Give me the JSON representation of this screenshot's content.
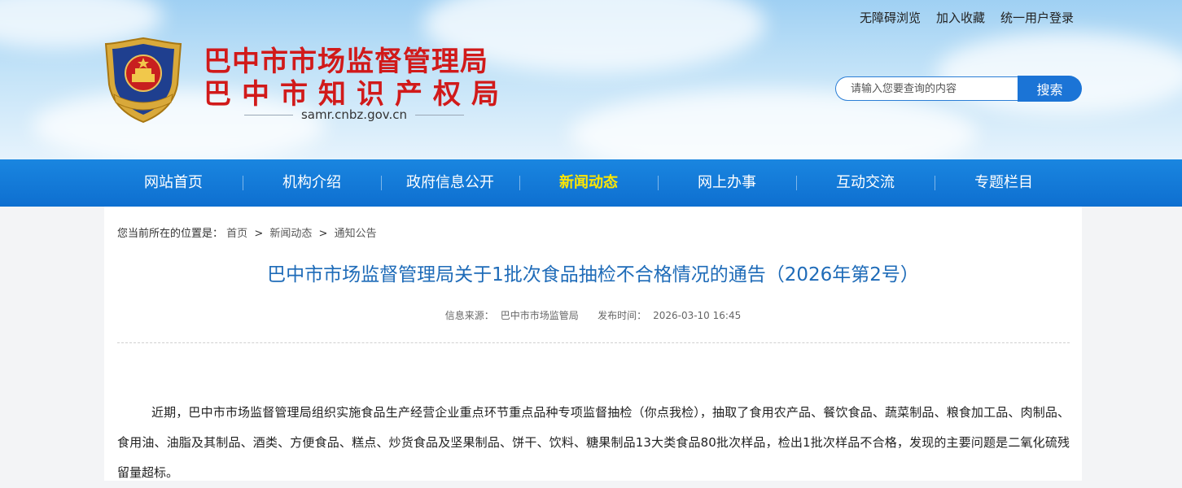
{
  "header": {
    "top_links": [
      "无障碍浏览",
      "加入收藏",
      "统一用户登录"
    ],
    "title_line1": "巴中市市场监督管理局",
    "title_line2": "巴中市知识产权局",
    "domain": "samr.cnbz.gov.cn",
    "emblem_text": "市场监督管理",
    "search": {
      "placeholder": "请输入您要查询的内容",
      "button_label": "搜索"
    }
  },
  "nav": {
    "items": [
      {
        "label": "网站首页"
      },
      {
        "label": "机构介绍"
      },
      {
        "label": "政府信息公开"
      },
      {
        "label": "新闻动态"
      },
      {
        "label": "网上办事"
      },
      {
        "label": "互动交流"
      },
      {
        "label": "专题栏目"
      }
    ],
    "active_index": 3,
    "active_color": "#ffe600"
  },
  "breadcrumb": {
    "prefix": "您当前所在的位置是：",
    "items": [
      "首页",
      "新闻动态",
      "通知公告"
    ],
    "separator": ">"
  },
  "article": {
    "title": "巴中市市场监督管理局关于1批次食品抽检不合格情况的通告（2026年第2号）",
    "source_label": "信息来源：",
    "source": "巴中市市场监管局",
    "date_label": "发布时间：",
    "date": "2026-03-10 16:45",
    "body": "近期，巴中市市场监督管理局组织实施食品生产经营企业重点环节重点品种专项监督抽检（你点我检），抽取了食用农产品、餐饮食品、蔬菜制品、粮食加工品、肉制品、食用油、油脂及其制品、酒类、方便食品、糕点、炒货食品及坚果制品、饼干、饮料、糖果制品13大类食品80批次样品，检出1批次样品不合格，发现的主要问题是二氧化硫残留量超标。"
  },
  "colors": {
    "title_red": "#d11a1a",
    "nav_blue": "#0e6fd0",
    "article_title_blue": "#1e6bb8"
  }
}
